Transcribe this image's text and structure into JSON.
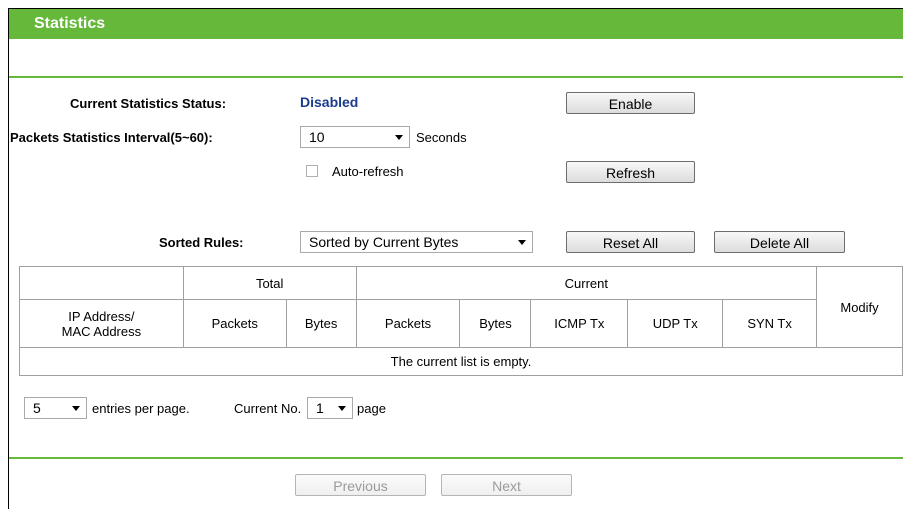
{
  "header": {
    "title": "Statistics"
  },
  "settings": {
    "status_label": "Current Statistics Status:",
    "status_value": "Disabled",
    "enable_button": "Enable",
    "interval_label": "Packets Statistics Interval(5~60):",
    "interval_value": "10",
    "interval_unit": "Seconds",
    "autorefresh_label": "Auto-refresh",
    "refresh_button": "Refresh",
    "sorted_label": "Sorted Rules:",
    "sorted_value": "Sorted by Current Bytes",
    "reset_all_button": "Reset All",
    "delete_all_button": "Delete All"
  },
  "table": {
    "group_total": "Total",
    "group_current": "Current",
    "col_modify": "Modify",
    "col_ip_line1": "IP Address/",
    "col_ip_line2": "MAC Address",
    "col_total_packets": "Packets",
    "col_total_bytes": "Bytes",
    "col_cur_packets": "Packets",
    "col_cur_bytes": "Bytes",
    "col_icmp": "ICMP Tx",
    "col_udp": "UDP Tx",
    "col_syn": "SYN Tx",
    "empty_message": "The current list is empty."
  },
  "pagination": {
    "entries_value": "5",
    "entries_label": "entries per page.",
    "current_no_label": "Current No.",
    "page_value": "1",
    "page_label": "page",
    "previous_button": "Previous",
    "next_button": "Next"
  },
  "colors": {
    "header_green": "#66b83a",
    "status_blue": "#1a3c8a"
  }
}
